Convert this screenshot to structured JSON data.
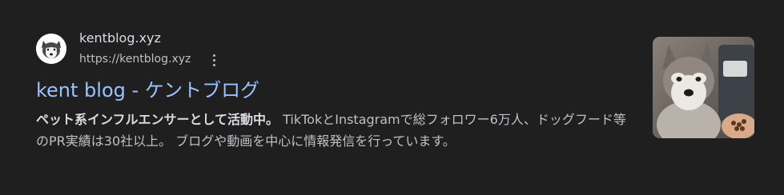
{
  "result": {
    "site_name": "kentblog.xyz",
    "url": "https://kentblog.xyz",
    "title": "kent blog - ケントブログ",
    "snippet_bold": "ペット系インフルエンサーとして活動中。",
    "snippet_rest": " TikTokとInstagramで総フォロワー6万人、ドッグフード等のPR実績は30社以上。 ブログや動画を中心に情報発信を行っています。",
    "favicon_icon": "husky-dog-icon",
    "thumbnail_icon": "husky-dog-photo",
    "more_icon": "vertical-dots-icon"
  },
  "colors": {
    "background": "#1f1f1f",
    "title": "#99c3ff",
    "text": "#bdc1c6"
  }
}
